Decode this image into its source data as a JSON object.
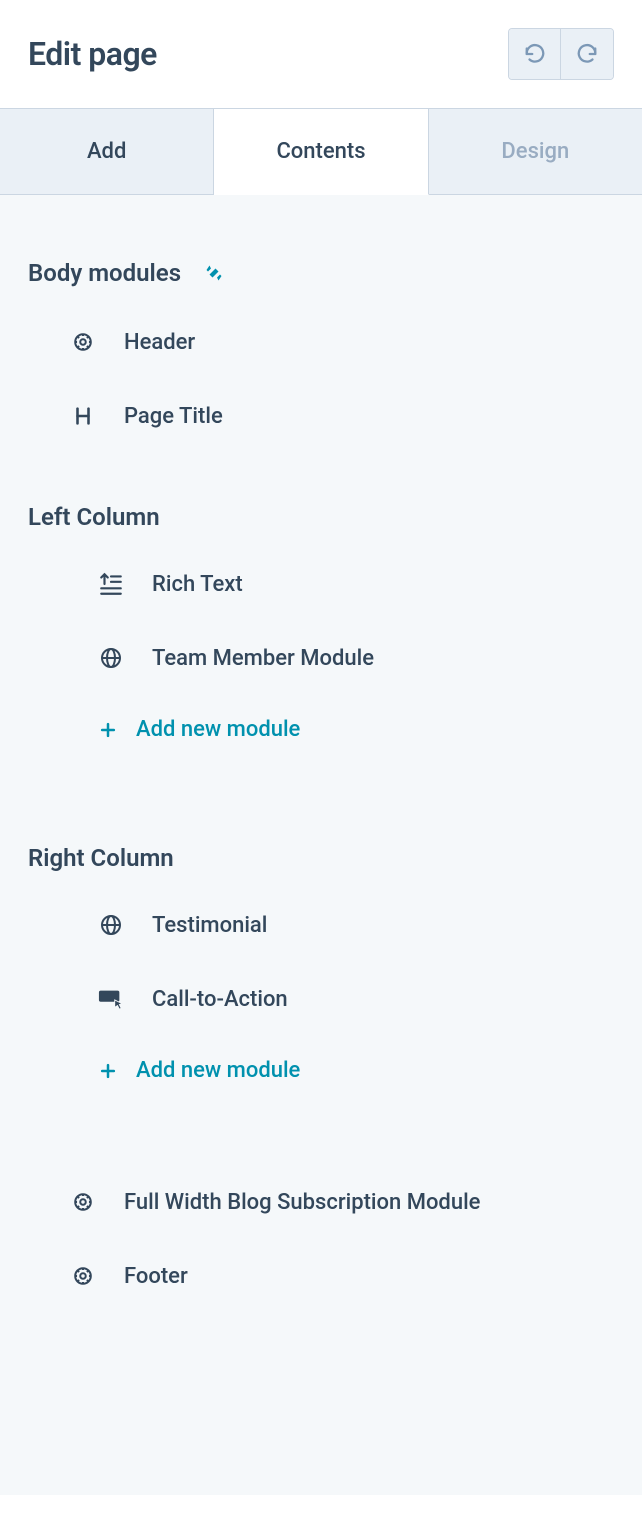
{
  "header": {
    "title": "Edit page"
  },
  "tabs": {
    "add": "Add",
    "contents": "Contents",
    "design": "Design"
  },
  "sections": {
    "body_modules": {
      "title": "Body modules",
      "items": [
        {
          "label": "Header",
          "icon": "sprocket"
        },
        {
          "label": "Page Title",
          "icon": "heading"
        }
      ]
    },
    "left_column": {
      "title": "Left Column",
      "items": [
        {
          "label": "Rich Text",
          "icon": "richtext"
        },
        {
          "label": "Team Member Module",
          "icon": "globe"
        }
      ],
      "add_label": "Add new module"
    },
    "right_column": {
      "title": "Right Column",
      "items": [
        {
          "label": "Testimonial",
          "icon": "globe"
        },
        {
          "label": "Call-to-Action",
          "icon": "cta"
        }
      ],
      "add_label": "Add new module"
    },
    "body_bottom": {
      "items": [
        {
          "label": "Full Width Blog Subscription Module",
          "icon": "sprocket"
        },
        {
          "label": "Footer",
          "icon": "sprocket"
        }
      ]
    }
  }
}
